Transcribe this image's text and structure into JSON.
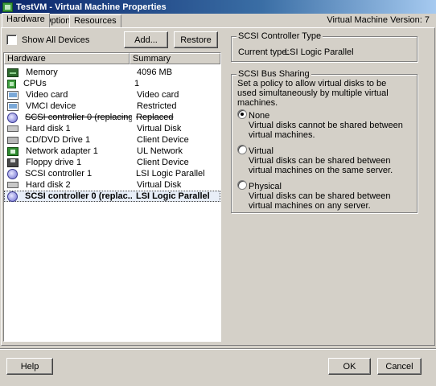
{
  "window": {
    "title": "TestVM - Virtual Machine Properties",
    "version_label": "Virtual Machine Version: 7"
  },
  "tabs": [
    {
      "label": "Hardware"
    },
    {
      "label": "Options"
    },
    {
      "label": "Resources"
    }
  ],
  "hardware": {
    "show_all_label": "Show All Devices",
    "add_label": "Add...",
    "restore_label": "Restore",
    "columns": [
      "Hardware",
      "Summary"
    ],
    "rows": [
      {
        "icon": "memory-icon",
        "name": "Memory",
        "summary": "4096 MB"
      },
      {
        "icon": "cpu-icon",
        "name": "CPUs",
        "summary": "1"
      },
      {
        "icon": "video-card-icon",
        "name": "Video card",
        "summary": "Video card"
      },
      {
        "icon": "vmci-device-icon",
        "name": "VMCI device",
        "summary": "Restricted"
      },
      {
        "icon": "scsi-controller-icon",
        "name": "SCSI controller 0 (replacing)",
        "summary": "Replaced"
      },
      {
        "icon": "hard-disk-icon",
        "name": "Hard disk 1",
        "summary": "Virtual Disk"
      },
      {
        "icon": "cd-dvd-drive-icon",
        "name": "CD/DVD Drive 1",
        "summary": "Client Device"
      },
      {
        "icon": "network-adapter-icon",
        "name": "Network adapter 1",
        "summary": "UL Network"
      },
      {
        "icon": "floppy-drive-icon",
        "name": "Floppy drive 1",
        "summary": "Client Device"
      },
      {
        "icon": "scsi-controller-icon",
        "name": "SCSI controller 1",
        "summary": "LSI Logic Parallel"
      },
      {
        "icon": "hard-disk-icon",
        "name": "Hard disk 2",
        "summary": "Virtual Disk"
      },
      {
        "icon": "scsi-controller-icon",
        "name": "SCSI controller 0 (replac...",
        "summary": "LSI Logic Parallel"
      }
    ]
  },
  "scsi_type": {
    "title": "SCSI Controller Type",
    "current_label": "Current type:",
    "current_value": "LSI Logic Parallel"
  },
  "bus_sharing": {
    "title": "SCSI Bus Sharing",
    "description": "Set a policy to allow virtual disks to be used simultaneously by multiple virtual machines.",
    "options": [
      {
        "label": "None",
        "description": "Virtual disks cannot be shared between virtual machines.",
        "selected": true
      },
      {
        "label": "Virtual",
        "description": "Virtual disks can be shared between virtual machines on the same server.",
        "selected": false
      },
      {
        "label": "Physical",
        "description": "Virtual disks can be shared between virtual machines on any server.",
        "selected": false
      }
    ]
  },
  "footer": {
    "help_label": "Help",
    "ok_label": "OK",
    "cancel_label": "Cancel"
  }
}
